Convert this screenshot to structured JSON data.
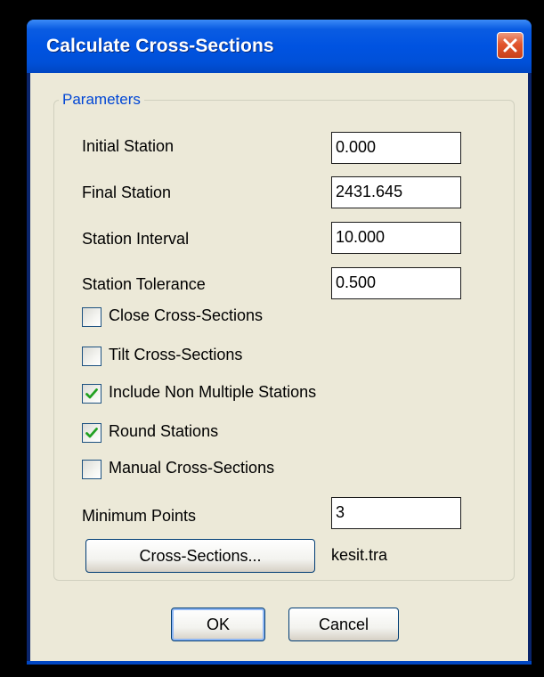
{
  "window": {
    "title": "Calculate Cross-Sections",
    "close_icon": "close-icon"
  },
  "parameters": {
    "group_label": "Parameters",
    "initial_station": {
      "label": "Initial Station",
      "value": "0.000"
    },
    "final_station": {
      "label": "Final Station",
      "value": "2431.645"
    },
    "station_interval": {
      "label": "Station Interval",
      "value": "10.000"
    },
    "station_tolerance": {
      "label": "Station Tolerance",
      "value": "0.500"
    },
    "close_cross_sections": {
      "label": "Close Cross-Sections",
      "checked": false
    },
    "tilt_cross_sections": {
      "label": "Tilt Cross-Sections",
      "checked": false
    },
    "include_non_multiple_stations": {
      "label": "Include Non Multiple Stations",
      "checked": true
    },
    "round_stations": {
      "label": "Round Stations",
      "checked": true
    },
    "manual_cross_sections": {
      "label": "Manual Cross-Sections",
      "checked": false
    },
    "minimum_points": {
      "label": "Minimum Points",
      "value": "3"
    },
    "cross_sections_button": "Cross-Sections...",
    "cross_sections_file": "kesit.tra"
  },
  "footer": {
    "ok_label": "OK",
    "cancel_label": "Cancel"
  },
  "colors": {
    "titlebar": "#0053e1",
    "dialog_background": "#ece9d8",
    "group_label": "#0046d5",
    "check_mark": "#21a121",
    "close_button": "#e2552d"
  }
}
